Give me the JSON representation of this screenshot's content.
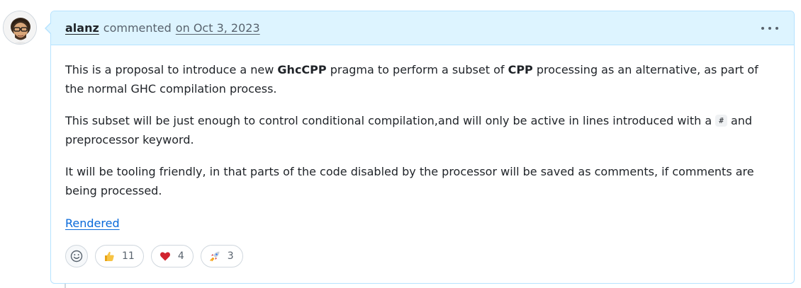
{
  "comment": {
    "author": "alanz",
    "action": "commented",
    "timestamp": "on Oct 3, 2023",
    "paragraph1": {
      "t1": "This is a proposal to introduce a new ",
      "b1": "GhcCPP",
      "t2": " pragma to perform a subset of ",
      "b2": "CPP",
      "t3": " processing as an alternative, as part of the normal GHC compilation process."
    },
    "paragraph2": {
      "t1": "This subset will be just enough to control conditional compilation,and will only be active in lines introduced with a ",
      "code": "#",
      "t2": " and preprocessor keyword."
    },
    "paragraph3": "It will be tooling friendly, in that parts of the code disabled by the processor will be saved as comments, if comments are being processed.",
    "link_text": "Rendered"
  },
  "reactions": [
    {
      "icon": "thumbs-up-icon",
      "count": "11"
    },
    {
      "icon": "heart-icon",
      "count": "4"
    },
    {
      "icon": "rocket-icon",
      "count": "3"
    }
  ],
  "colors": {
    "header_bg": "#ddf4ff",
    "border": "#b6e3ff",
    "link": "#0969da"
  }
}
